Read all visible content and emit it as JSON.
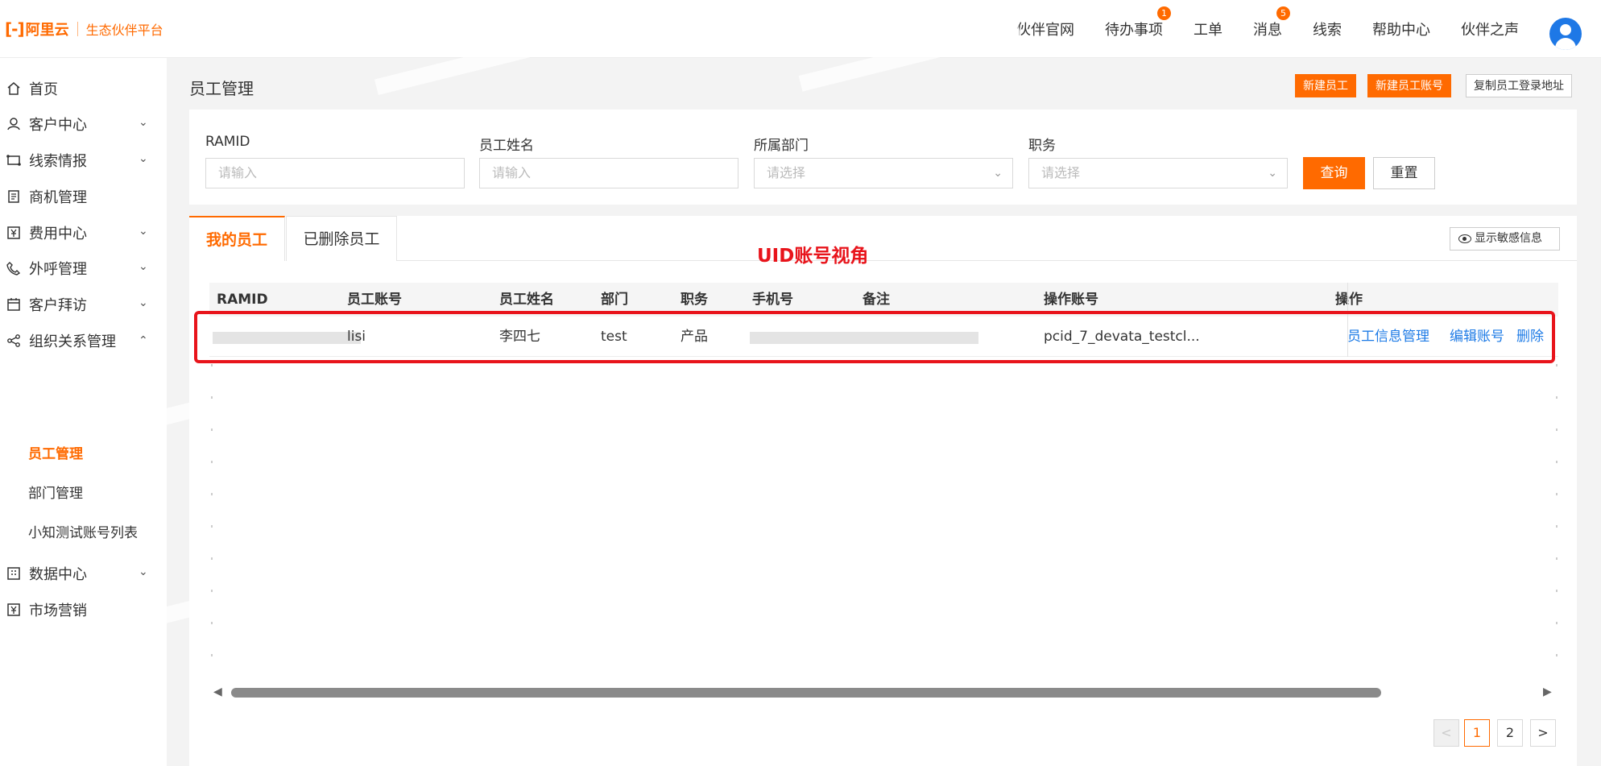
{
  "brand": {
    "logo_mark": "[-]",
    "logo_text": "阿里云",
    "platform": "生态伙伴平台"
  },
  "topnav": [
    {
      "label": "伙伴官网",
      "badge": ""
    },
    {
      "label": "待办事项",
      "badge": "1"
    },
    {
      "label": "工单",
      "badge": ""
    },
    {
      "label": "消息",
      "badge": "5"
    },
    {
      "label": "线索",
      "badge": ""
    },
    {
      "label": "帮助中心",
      "badge": ""
    },
    {
      "label": "伙伴之声",
      "badge": ""
    }
  ],
  "sidebar": {
    "items": [
      {
        "label": "首页",
        "icon": "home-icon"
      },
      {
        "label": "客户中心",
        "icon": "user-icon"
      },
      {
        "label": "线索情报",
        "icon": "nodes-icon"
      },
      {
        "label": "商机管理",
        "icon": "document-icon"
      },
      {
        "label": "费用中心",
        "icon": "yen-icon"
      },
      {
        "label": "外呼管理",
        "icon": "phone-icon"
      },
      {
        "label": "客户拜访",
        "icon": "calendar-icon"
      },
      {
        "label": "组织关系管理",
        "icon": "share-icon"
      },
      {
        "label": "数据中心",
        "icon": "grid-icon"
      },
      {
        "label": "市场营销",
        "icon": "yen-icon"
      }
    ],
    "sub_items": [
      "员工管理",
      "部门管理",
      "小知测试账号列表"
    ]
  },
  "page": {
    "title": "员工管理",
    "buttons": {
      "new_employee": "新建员工",
      "new_account": "新建员工账号",
      "copy_login": "复制员工登录地址"
    }
  },
  "filters": {
    "ramid_label": "RAMID",
    "ramid_placeholder": "请输入",
    "name_label": "员工姓名",
    "name_placeholder": "请输入",
    "dept_label": "所属部门",
    "dept_placeholder": "请选择",
    "role_label": "职务",
    "role_placeholder": "请选择",
    "query": "查询",
    "reset": "重置"
  },
  "tabs": {
    "active": "我的员工",
    "inactive": "已删除员工"
  },
  "annotation": "UID账号视角",
  "sensitive_button": "显示敏感信息",
  "table": {
    "headers": [
      "RAMID",
      "员工账号",
      "员工姓名",
      "部门",
      "职务",
      "手机号",
      "备注",
      "操作账号",
      "操作"
    ],
    "row": {
      "account": "lisi",
      "name": "李四七",
      "dept": "test",
      "role": "产品",
      "operator": "pcid_7_devata_testcl...",
      "actions": [
        "员工信息管理",
        "编辑账号",
        "删除"
      ]
    }
  },
  "pagination": {
    "prev": "<",
    "pages": [
      "1",
      "2"
    ],
    "next": ">",
    "current": "1"
  },
  "colors": {
    "accent": "#ff6a00",
    "link": "#1e7be6",
    "highlight": "#e8141b"
  }
}
